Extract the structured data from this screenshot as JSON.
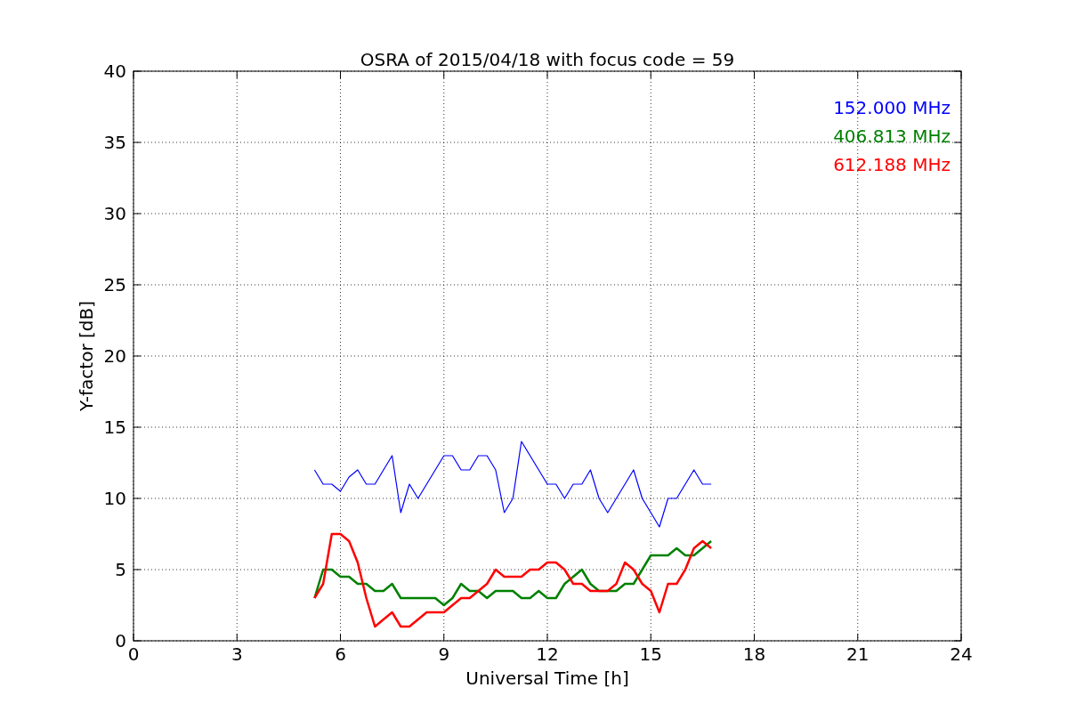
{
  "chart_data": {
    "type": "line",
    "title": "OSRA of 2015/04/18 with focus code = 59",
    "xlabel": "Universal Time [h]",
    "ylabel": "Y-factor [dB]",
    "x": [
      5.25,
      5.5,
      5.75,
      6,
      6.25,
      6.5,
      6.75,
      7,
      7.25,
      7.5,
      7.75,
      8,
      8.25,
      8.5,
      8.75,
      9,
      9.25,
      9.5,
      9.75,
      10,
      10.25,
      10.5,
      10.75,
      11,
      11.25,
      11.5,
      11.75,
      12,
      12.25,
      12.5,
      12.75,
      13,
      13.25,
      13.5,
      13.75,
      14,
      14.25,
      14.5,
      14.75,
      15,
      15.25,
      15.5,
      15.75,
      16,
      16.25,
      16.5,
      16.75
    ],
    "series": [
      {
        "name": "152.000 MHz",
        "color": "#0000ff",
        "values": [
          12,
          11,
          11,
          10.5,
          11.5,
          12,
          11,
          11,
          12,
          13,
          9,
          11,
          10,
          11,
          12,
          13,
          13,
          12,
          12,
          13,
          13,
          12,
          9,
          10,
          14,
          13,
          12,
          11,
          11,
          10,
          11,
          11,
          12,
          10,
          9,
          10,
          11,
          12,
          10,
          9,
          8,
          10,
          10,
          11,
          12,
          11,
          11
        ]
      },
      {
        "name": "406.813 MHz",
        "color": "#008000",
        "values": [
          3,
          5,
          5,
          4.5,
          4.5,
          4,
          4,
          3.5,
          3.5,
          4,
          3,
          3,
          3,
          3,
          3,
          2.5,
          3,
          4,
          3.5,
          3.5,
          3,
          3.5,
          3.5,
          3.5,
          3,
          3,
          3.5,
          3,
          3,
          4,
          4.5,
          5,
          4,
          3.5,
          3.5,
          3.5,
          4,
          4,
          5,
          6,
          6,
          6,
          6.5,
          6,
          6,
          6.5,
          7
        ]
      },
      {
        "name": "612.188 MHz",
        "color": "#ff0000",
        "values": [
          3,
          4,
          7.5,
          7.5,
          7,
          5.5,
          3,
          1,
          1.5,
          2,
          1,
          1,
          1.5,
          2,
          2,
          2,
          2.5,
          3,
          3,
          3.5,
          4,
          5,
          4.5,
          4.5,
          4.5,
          5,
          5,
          5.5,
          5.5,
          5,
          4,
          4,
          3.5,
          3.5,
          3.5,
          4,
          5.5,
          5,
          4,
          3.5,
          2,
          4,
          4,
          5,
          6.5,
          7,
          6.5
        ]
      }
    ],
    "grid": true,
    "xlim": [
      0,
      24
    ],
    "ylim": [
      0,
      40
    ],
    "xticks": [
      0,
      3,
      6,
      9,
      12,
      15,
      18,
      21,
      24
    ],
    "yticks": [
      0,
      5,
      10,
      15,
      20,
      25,
      30,
      35,
      40
    ]
  }
}
